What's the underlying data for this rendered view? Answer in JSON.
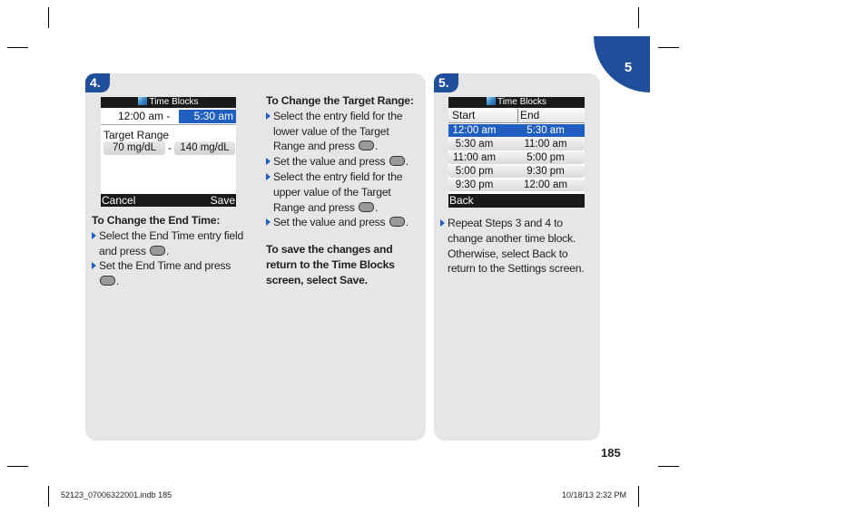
{
  "chapter": {
    "number": "5",
    "color": "#1f4f9c"
  },
  "page_number": "185",
  "slug": {
    "file": "52123_07006322001.indb   185",
    "date": "10/18/13   2:32 PM"
  },
  "step4": {
    "badge": "4.",
    "screen": {
      "title": "Time Blocks",
      "title_icon": "time-blocks-icon",
      "start_time": "12:00 am  -",
      "end_time": "5:30 am",
      "target_range_label": "Target Range",
      "low_value": "70 mg/dL",
      "dash": "-",
      "high_value": "140 mg/dL",
      "cancel": "Cancel",
      "save": "Save"
    },
    "end_time_section": {
      "heading": "To Change the End Time:",
      "bullets": [
        {
          "text": "Select the End Time entry field and press ",
          "suffix": "."
        },
        {
          "text": "Set the End Time and press ",
          "suffix": "."
        }
      ]
    },
    "target_range_section": {
      "heading": "To Change the Target Range:",
      "bullets": [
        {
          "text": "Select the entry field for the lower value of the Target Range and press ",
          "suffix": "."
        },
        {
          "text": "Set the value and press ",
          "suffix": "."
        },
        {
          "text": "Select the entry field for the upper value of the Target Range and press ",
          "suffix": "."
        },
        {
          "text": "Set the value and press ",
          "suffix": "."
        }
      ],
      "save_note": "To save the changes and return to the Time Blocks screen, select Save."
    }
  },
  "step5": {
    "badge": "5.",
    "screen": {
      "title": "Time Blocks",
      "columns": [
        "Start",
        "End"
      ],
      "rows": [
        {
          "start": "12:00 am",
          "end": "5:30 am",
          "selected": true
        },
        {
          "start": "5:30 am",
          "end": "11:00 am",
          "selected": false
        },
        {
          "start": "11:00 am",
          "end": "5:00 pm",
          "selected": false
        },
        {
          "start": "5:00 pm",
          "end": "9:30 pm",
          "selected": false
        },
        {
          "start": "9:30 pm",
          "end": "12:00 am",
          "selected": false
        }
      ],
      "back": "Back"
    },
    "bullet": "Repeat Steps 3 and 4 to change another time block. Otherwise, select Back to return to the Settings screen."
  }
}
